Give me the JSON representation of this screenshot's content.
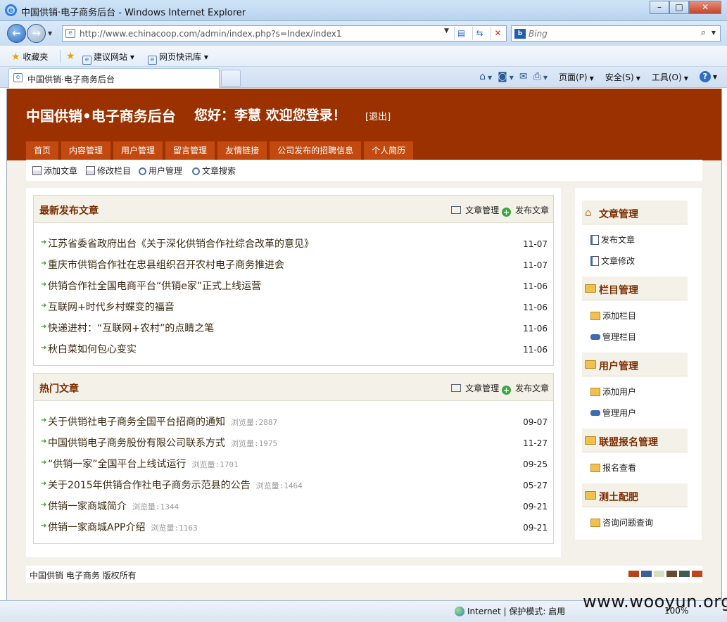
{
  "browser": {
    "window_title": "中国供销·电子商务后台 - Windows Internet Explorer",
    "url": "http://www.echinacoop.com/admin/index.php?s=Index/index1",
    "search_placeholder": "Bing",
    "favorites": {
      "label": "收藏夹",
      "items": [
        "建议网站",
        "网页快讯库"
      ]
    },
    "tab_title": "中国供销·电子商务后台",
    "commands": {
      "page": "页面(P)",
      "safety": "安全(S)",
      "tools": "工具(O)"
    },
    "status": {
      "zone": "Internet | 保护模式: 启用",
      "zoom": "100%"
    },
    "icons": [
      "ie-icon",
      "back-arrow-icon",
      "forward-arrow-icon",
      "compat-view-icon",
      "refresh-icon",
      "stop-icon",
      "bing-icon",
      "search-icon",
      "star-icon",
      "home-icon",
      "rss-icon",
      "mail-icon",
      "print-icon",
      "help-icon",
      "globe-icon"
    ]
  },
  "site": {
    "title": "中国供销•电子商务后台",
    "greeting": "您好：李慧 欢迎您登录！",
    "logout": "[退出]",
    "nav": [
      "首页",
      "内容管理",
      "用户管理",
      "留言管理",
      "友情链接",
      "公司发布的招聘信息",
      "个人简历"
    ],
    "subnav": [
      "添加文章",
      "修改栏目",
      "用户管理",
      "文章搜索"
    ],
    "accent_color": "#9c3100",
    "nav_color": "#c24a10"
  },
  "latest": {
    "title": "最新发布文章",
    "manage": "文章管理",
    "publish": "发布文章",
    "items": [
      {
        "title": "江苏省委省政府出台《关于深化供销合作社综合改革的意见》",
        "date": "11-07"
      },
      {
        "title": "重庆市供销合作社在忠县组织召开农村电子商务推进会",
        "date": "11-07"
      },
      {
        "title": "供销合作社全国电商平台“供销e家”正式上线运营",
        "date": "11-06"
      },
      {
        "title": "互联网+时代乡村蝶变的福音",
        "date": "11-06"
      },
      {
        "title": "快递进村：“互联网+农村”的点睛之笔",
        "date": "11-06"
      },
      {
        "title": "秋白菜如何包心变实",
        "date": "11-06"
      }
    ]
  },
  "hot": {
    "title": "热门文章",
    "manage": "文章管理",
    "publish": "发布文章",
    "items": [
      {
        "title": "关于供销社电子商务全国平台招商的通知",
        "views": "浏览量:2887",
        "date": "09-07"
      },
      {
        "title": "中国供销电子商务股份有限公司联系方式",
        "views": "浏览量:1975",
        "date": "11-27"
      },
      {
        "title": "“供销一家”全国平台上线试运行",
        "views": "浏览量:1701",
        "date": "09-25"
      },
      {
        "title": "关于2015年供销合作社电子商务示范县的公告",
        "views": "浏览量:1464",
        "date": "05-27"
      },
      {
        "title": "供销一家商城简介",
        "views": "浏览量:1344",
        "date": "09-21"
      },
      {
        "title": "供销一家商城APP介绍",
        "views": "浏览量:1163",
        "date": "09-21"
      }
    ]
  },
  "sidebar": [
    {
      "title": "文章管理",
      "items": [
        "发布文章",
        "文章修改"
      ]
    },
    {
      "title": "栏目管理",
      "items": [
        "添加栏目",
        "管理栏目"
      ]
    },
    {
      "title": "用户管理",
      "items": [
        "添加用户",
        "管理用户"
      ]
    },
    {
      "title": "联盟报名管理",
      "items": [
        "报名查看"
      ]
    },
    {
      "title": "测土配肥",
      "items": [
        "咨询问题查询"
      ]
    }
  ],
  "footer": {
    "text": "中国供销 电子商务 版权所有",
    "swatches": [
      "#b9431a",
      "#3c5f9c",
      "#d6dfc2",
      "#6b4a2e",
      "#3f5c52",
      "#c2461c"
    ]
  },
  "watermark": "www.wooyun.org"
}
